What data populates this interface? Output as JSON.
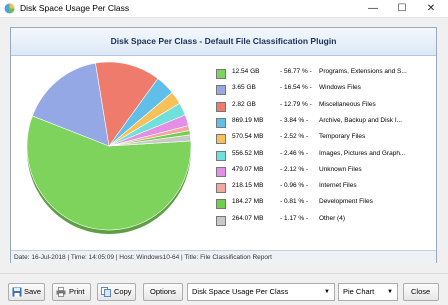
{
  "window": {
    "title": "Disk Space Usage Per Class",
    "minimize": "—",
    "maximize": "☐",
    "close": "✕"
  },
  "panel": {
    "header": "Disk Space Per Class - Default File Classification Plugin",
    "footer": "Date: 16-Jul-2018 | Time: 14:05:09 | Host: Windows10-64 | Title: File Classification Report"
  },
  "chart_data": {
    "type": "pie",
    "slices": [
      {
        "label": "Programs, Extensions and S...",
        "size": "12.54 GB",
        "pct_label": "- 56.77 % -",
        "value": 56.77,
        "color": "#7dd35b"
      },
      {
        "label": "Windows Files",
        "size": "3.65 GB",
        "pct_label": "- 16.54 % -",
        "value": 16.54,
        "color": "#95a8e6"
      },
      {
        "label": "Miscellaneous Files",
        "size": "2.82 GB",
        "pct_label": "- 12.79 % -",
        "value": 12.79,
        "color": "#ee7b6b"
      },
      {
        "label": "Archive, Backup and Disk I...",
        "size": "869.19 MB",
        "pct_label": "- 3.84 % -",
        "value": 3.84,
        "color": "#5fbfe8"
      },
      {
        "label": "Temporary Files",
        "size": "570.54 MB",
        "pct_label": "- 2.52 % -",
        "value": 2.52,
        "color": "#f6c15a"
      },
      {
        "label": "Images, Pictures and Graph...",
        "size": "556.52 MB",
        "pct_label": "- 2.46 % -",
        "value": 2.46,
        "color": "#6fe0dc"
      },
      {
        "label": "Unknown Files",
        "size": "479.07 MB",
        "pct_label": "- 2.12 % -",
        "value": 2.12,
        "color": "#e48fe6"
      },
      {
        "label": "Internet Files",
        "size": "218.15 MB",
        "pct_label": "- 0.96 % -",
        "value": 0.96,
        "color": "#f4a7a0"
      },
      {
        "label": "Development Files",
        "size": "184.27 MB",
        "pct_label": "- 0.81 % -",
        "value": 0.81,
        "color": "#6fcf4a"
      },
      {
        "label": "Other (4)",
        "size": "264.07 MB",
        "pct_label": "- 1.17 % -",
        "value": 1.17,
        "color": "#c8c8c8"
      }
    ]
  },
  "toolbar": {
    "save": "Save",
    "print": "Print",
    "copy": "Copy",
    "options": "Options",
    "report_select": "Disk Space Usage Per Class",
    "chart_type_select": "Pie Chart",
    "close": "Close"
  }
}
